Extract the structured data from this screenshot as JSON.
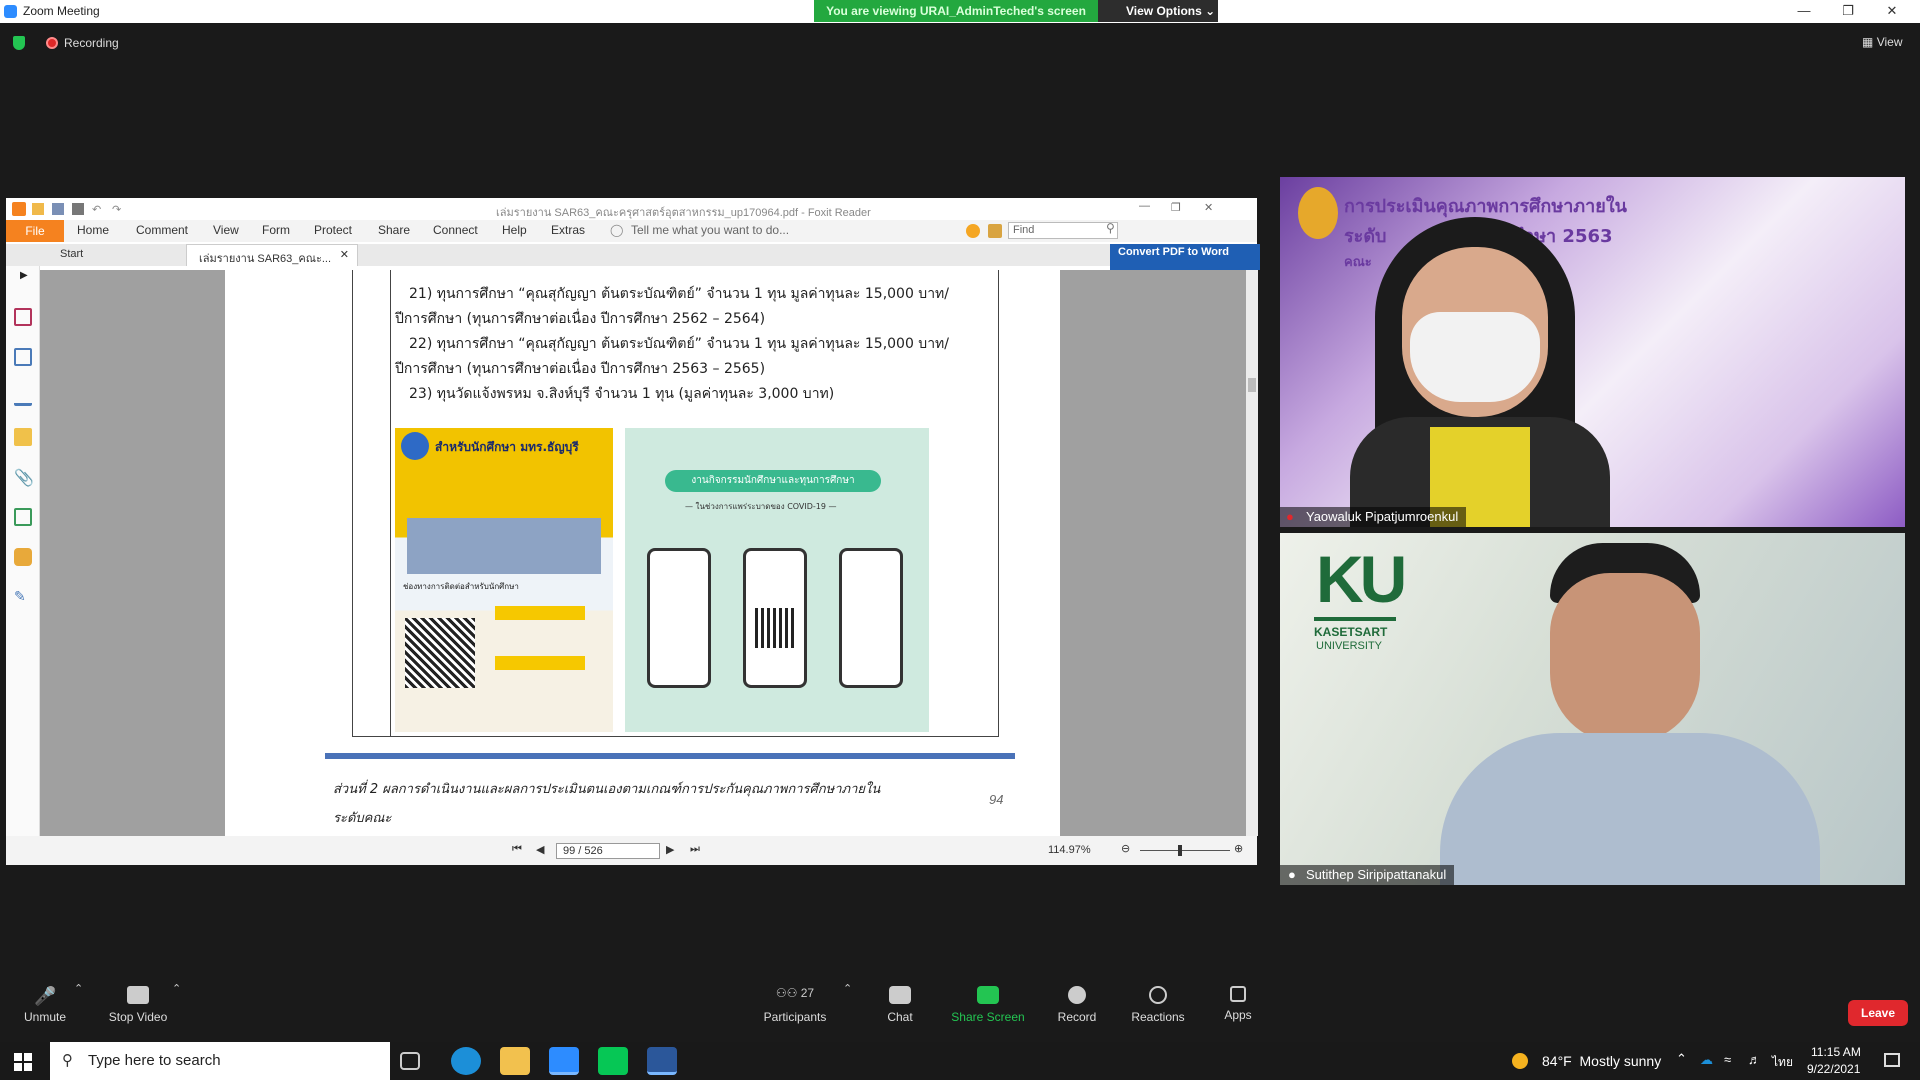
{
  "window": {
    "title": "Zoom Meeting",
    "banner": "You are viewing URAI_AdminTeched's screen",
    "view_options": "View Options",
    "recording": "Recording",
    "view": "View"
  },
  "foxit": {
    "title": "เล่มรายงาน SAR63_คณะครุศาสตร์อุตสาหกรรม_up170964.pdf - Foxit Reader",
    "menu": [
      "File",
      "Home",
      "Comment",
      "View",
      "Form",
      "Protect",
      "Share",
      "Connect",
      "Help",
      "Extras"
    ],
    "tell_me": "Tell me what you want to do...",
    "find_placeholder": "Find",
    "tabs": {
      "start": "Start",
      "doc": "เล่มรายงาน SAR63_คณะ..."
    },
    "convert": "Convert PDF to Word",
    "page_lines": [
      "21) ทุนการศึกษา “คุณสุกัญญา ต้นตระบัณฑิตย์” จำนวน 1 ทุน มูลค่าทุนละ 15,000 บาท/",
      "ปีการศึกษา (ทุนการศึกษาต่อเนื่อง ปีการศึกษา 2562 – 2564)",
      "22) ทุนการศึกษา “คุณสุกัญญา ต้นตระบัณฑิตย์” จำนวน 1 ทุน มูลค่าทุนละ 15,000 บาท/",
      "ปีการศึกษา (ทุนการศึกษาต่อเนื่อง ปีการศึกษา 2563 – 2565)",
      "23) ทุนวัดแจ้งพรหม จ.สิงห์บุรี จำนวน 1 ทุน (มูลค่าทุนละ 3,000 บาท)"
    ],
    "poster_left": {
      "title": "สำหรับนักศึกษา มทร.ธัญบุรี",
      "subtitle": "ช่องทางการติดต่อสำหรับนักศึกษา"
    },
    "poster_right": {
      "title": "งานกิจกรรมนักศึกษาและทุนการศึกษา",
      "subtitle": "— ในช่วงการแพร่ระบาดของ COVID-19 —"
    },
    "footer_text_1": "ส่วนที่ 2 ผลการดำเนินงานและผลการประเมินตนเองตามเกณฑ์การประกันคุณภาพการศึกษาภายใน",
    "footer_text_2": "ระดับคณะ",
    "page_number": "94",
    "page_box": "99 / 526",
    "zoom": "114.97%"
  },
  "videos": [
    {
      "name": "Yaowaluk Pipatjumroenkul",
      "slide_line1": "การประเมินคุณภาพการศึกษาภายใน",
      "slide_line2": "ระดับ          จำปีการศึกษา 2563",
      "slide_line3": "คณะ                         รรม"
    },
    {
      "name": "Sutithep Siripipattanakul",
      "logo_big": "KU",
      "logo_line1": "KASETSART",
      "logo_line2": "UNIVERSITY"
    }
  ],
  "toolbar": {
    "unmute": "Unmute",
    "stop_video": "Stop Video",
    "participants": "Participants",
    "participant_count": "27",
    "chat": "Chat",
    "share": "Share Screen",
    "record": "Record",
    "reactions": "Reactions",
    "apps": "Apps",
    "leave": "Leave"
  },
  "taskbar": {
    "search": "Type here to search",
    "weather": "84°F  Mostly sunny",
    "lang": "ไทย",
    "time": "11:15 AM",
    "date": "9/22/2021"
  },
  "colors": {
    "zoom_green": "#23a83f",
    "foxit_orange": "#f5821f",
    "leave_red": "#e0282d",
    "share_green": "#23c552"
  }
}
